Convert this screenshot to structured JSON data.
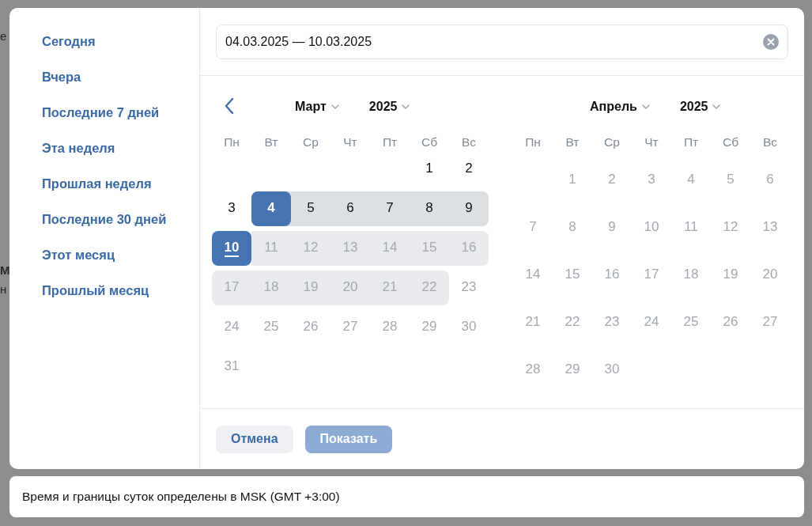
{
  "backdrop": {
    "fragments": [
      "е",
      "М",
      "н"
    ]
  },
  "presets": [
    {
      "label": "Сегодня"
    },
    {
      "label": "Вчера"
    },
    {
      "label": "Последние 7 дней"
    },
    {
      "label": "Эта неделя"
    },
    {
      "label": "Прошлая неделя"
    },
    {
      "label": "Последние 30 дней"
    },
    {
      "label": "Этот месяц"
    },
    {
      "label": "Прошлый месяц"
    }
  ],
  "date_field": {
    "value": "04.03.2025 — 10.03.2025"
  },
  "months": [
    {
      "month": "Март",
      "year": "2025",
      "prev_button": true,
      "weekdays": [
        "Пн",
        "Вт",
        "Ср",
        "Чт",
        "Пт",
        "Сб",
        "Вс"
      ],
      "weeks": [
        [
          {
            "kind": "blank"
          },
          {
            "kind": "blank"
          },
          {
            "kind": "blank"
          },
          {
            "kind": "blank"
          },
          {
            "kind": "blank"
          },
          {
            "day": "1",
            "kind": "plain",
            "today": false
          },
          {
            "day": "2",
            "kind": "plain",
            "today": false
          }
        ],
        [
          {
            "day": "3",
            "kind": "plain",
            "today": false
          },
          {
            "day": "4",
            "kind": "start",
            "today": false
          },
          {
            "day": "5",
            "kind": "range",
            "today": false
          },
          {
            "day": "6",
            "kind": "range",
            "today": false
          },
          {
            "day": "7",
            "kind": "range",
            "today": false
          },
          {
            "day": "8",
            "kind": "range",
            "today": false
          },
          {
            "day": "9",
            "kind": "range",
            "today": false
          }
        ],
        [
          {
            "day": "10",
            "kind": "end",
            "today": true
          },
          {
            "day": "11",
            "kind": "preview",
            "today": false
          },
          {
            "day": "12",
            "kind": "preview",
            "today": false
          },
          {
            "day": "13",
            "kind": "preview",
            "today": false
          },
          {
            "day": "14",
            "kind": "preview",
            "today": false
          },
          {
            "day": "15",
            "kind": "preview",
            "today": false
          },
          {
            "day": "16",
            "kind": "preview",
            "today": false
          }
        ],
        [
          {
            "day": "17",
            "kind": "preview",
            "today": false
          },
          {
            "day": "18",
            "kind": "preview",
            "today": false
          },
          {
            "day": "19",
            "kind": "preview",
            "today": false
          },
          {
            "day": "20",
            "kind": "preview",
            "today": false
          },
          {
            "day": "21",
            "kind": "preview",
            "today": false
          },
          {
            "day": "22",
            "kind": "preview",
            "today": false
          },
          {
            "day": "23",
            "kind": "muted",
            "today": false
          }
        ],
        [
          {
            "day": "24",
            "kind": "muted",
            "today": false
          },
          {
            "day": "25",
            "kind": "muted",
            "today": false
          },
          {
            "day": "26",
            "kind": "muted",
            "today": false
          },
          {
            "day": "27",
            "kind": "muted",
            "today": false
          },
          {
            "day": "28",
            "kind": "muted",
            "today": false
          },
          {
            "day": "29",
            "kind": "muted",
            "today": false
          },
          {
            "day": "30",
            "kind": "muted",
            "today": false
          }
        ],
        [
          {
            "day": "31",
            "kind": "muted",
            "today": false
          }
        ]
      ]
    },
    {
      "month": "Апрель",
      "year": "2025",
      "prev_button": false,
      "weekdays": [
        "Пн",
        "Вт",
        "Ср",
        "Чт",
        "Пт",
        "Сб",
        "Вс"
      ],
      "weeks": [
        [
          {
            "kind": "blank"
          },
          {
            "day": "1",
            "kind": "muted",
            "today": false
          },
          {
            "day": "2",
            "kind": "muted",
            "today": false
          },
          {
            "day": "3",
            "kind": "muted",
            "today": false
          },
          {
            "day": "4",
            "kind": "muted",
            "today": false
          },
          {
            "day": "5",
            "kind": "muted",
            "today": false
          },
          {
            "day": "6",
            "kind": "muted",
            "today": false
          }
        ],
        [
          {
            "day": "7",
            "kind": "muted",
            "today": false
          },
          {
            "day": "8",
            "kind": "muted",
            "today": false
          },
          {
            "day": "9",
            "kind": "muted",
            "today": false
          },
          {
            "day": "10",
            "kind": "muted",
            "today": false
          },
          {
            "day": "11",
            "kind": "muted",
            "today": false
          },
          {
            "day": "12",
            "kind": "muted",
            "today": false
          },
          {
            "day": "13",
            "kind": "muted",
            "today": false
          }
        ],
        [
          {
            "day": "14",
            "kind": "muted",
            "today": false
          },
          {
            "day": "15",
            "kind": "muted",
            "today": false
          },
          {
            "day": "16",
            "kind": "muted",
            "today": false
          },
          {
            "day": "17",
            "kind": "muted",
            "today": false
          },
          {
            "day": "18",
            "kind": "muted",
            "today": false
          },
          {
            "day": "19",
            "kind": "muted",
            "today": false
          },
          {
            "day": "20",
            "kind": "muted",
            "today": false
          }
        ],
        [
          {
            "day": "21",
            "kind": "muted",
            "today": false
          },
          {
            "day": "22",
            "kind": "muted",
            "today": false
          },
          {
            "day": "23",
            "kind": "muted",
            "today": false
          },
          {
            "day": "24",
            "kind": "muted",
            "today": false
          },
          {
            "day": "25",
            "kind": "muted",
            "today": false
          },
          {
            "day": "26",
            "kind": "muted",
            "today": false
          },
          {
            "day": "27",
            "kind": "muted",
            "today": false
          }
        ],
        [
          {
            "day": "28",
            "kind": "muted",
            "today": false
          },
          {
            "day": "29",
            "kind": "muted",
            "today": false
          },
          {
            "day": "30",
            "kind": "muted",
            "today": false
          }
        ]
      ]
    }
  ],
  "buttons": [
    {
      "label": "Отмена",
      "kind": "secondary",
      "disabled": false
    },
    {
      "label": "Показать",
      "kind": "primary",
      "disabled": true
    }
  ],
  "timezone_note": "Время и границы суток определены в MSK (GMT +3:00)"
}
